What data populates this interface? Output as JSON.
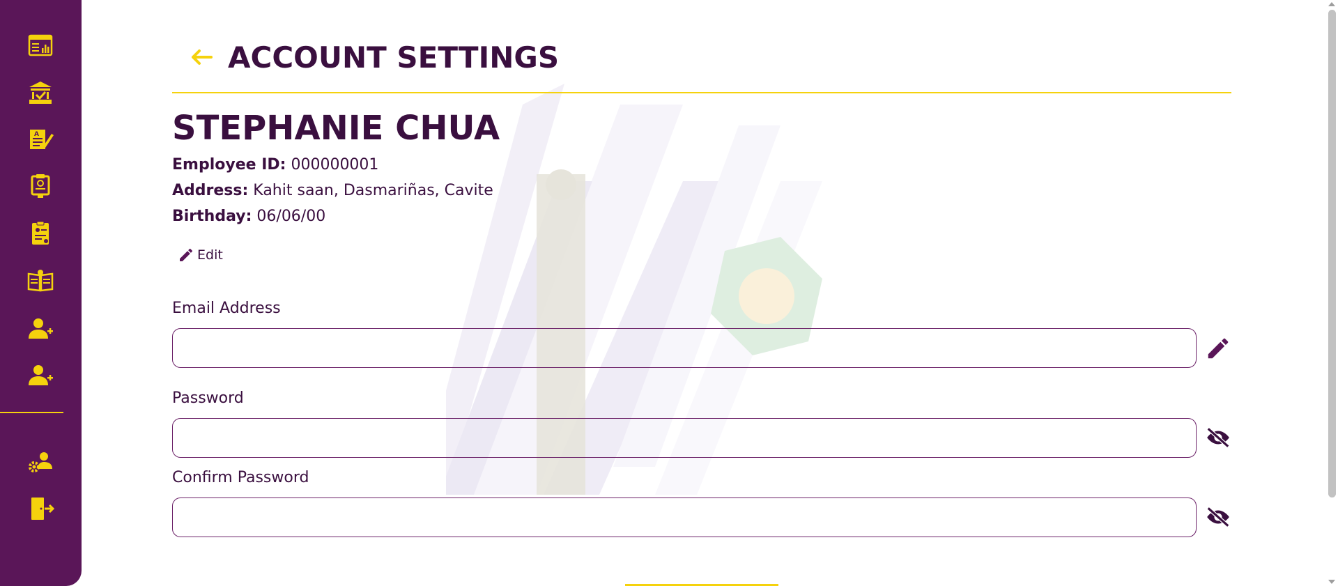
{
  "sidebar": {
    "items": [
      {
        "icon": "dashboard-chart-icon"
      },
      {
        "icon": "building-check-icon"
      },
      {
        "icon": "document-edit-icon"
      },
      {
        "icon": "clipboard-report-icon"
      },
      {
        "icon": "clipboard-profile-icon"
      },
      {
        "icon": "open-book-icon"
      },
      {
        "icon": "add-user-icon"
      },
      {
        "icon": "add-user-icon"
      }
    ],
    "bottom_items": [
      {
        "icon": "user-settings-icon"
      },
      {
        "icon": "logout-door-icon"
      }
    ],
    "colors": {
      "background": "#5a1658",
      "icon": "#f5d20d"
    }
  },
  "header": {
    "title": "ACCOUNT SETTINGS"
  },
  "profile": {
    "name": "STEPHANIE CHUA",
    "employee_id_label": "Employee ID:",
    "employee_id": "000000001",
    "address_label": "Address:",
    "address": "Kahit saan, Dasmariñas, Cavite",
    "birthday_label": "Birthday:",
    "birthday": "06/06/00",
    "edit_label": "Edit"
  },
  "form": {
    "email": {
      "label": "Email Address",
      "value": "",
      "placeholder": ""
    },
    "password": {
      "label": "Password",
      "value": "",
      "placeholder": ""
    },
    "confirm_password": {
      "label": "Confirm Password",
      "value": "",
      "placeholder": ""
    }
  },
  "colors": {
    "accent": "#f5d20d",
    "primary": "#3a0f3f",
    "border": "#6b2168"
  }
}
